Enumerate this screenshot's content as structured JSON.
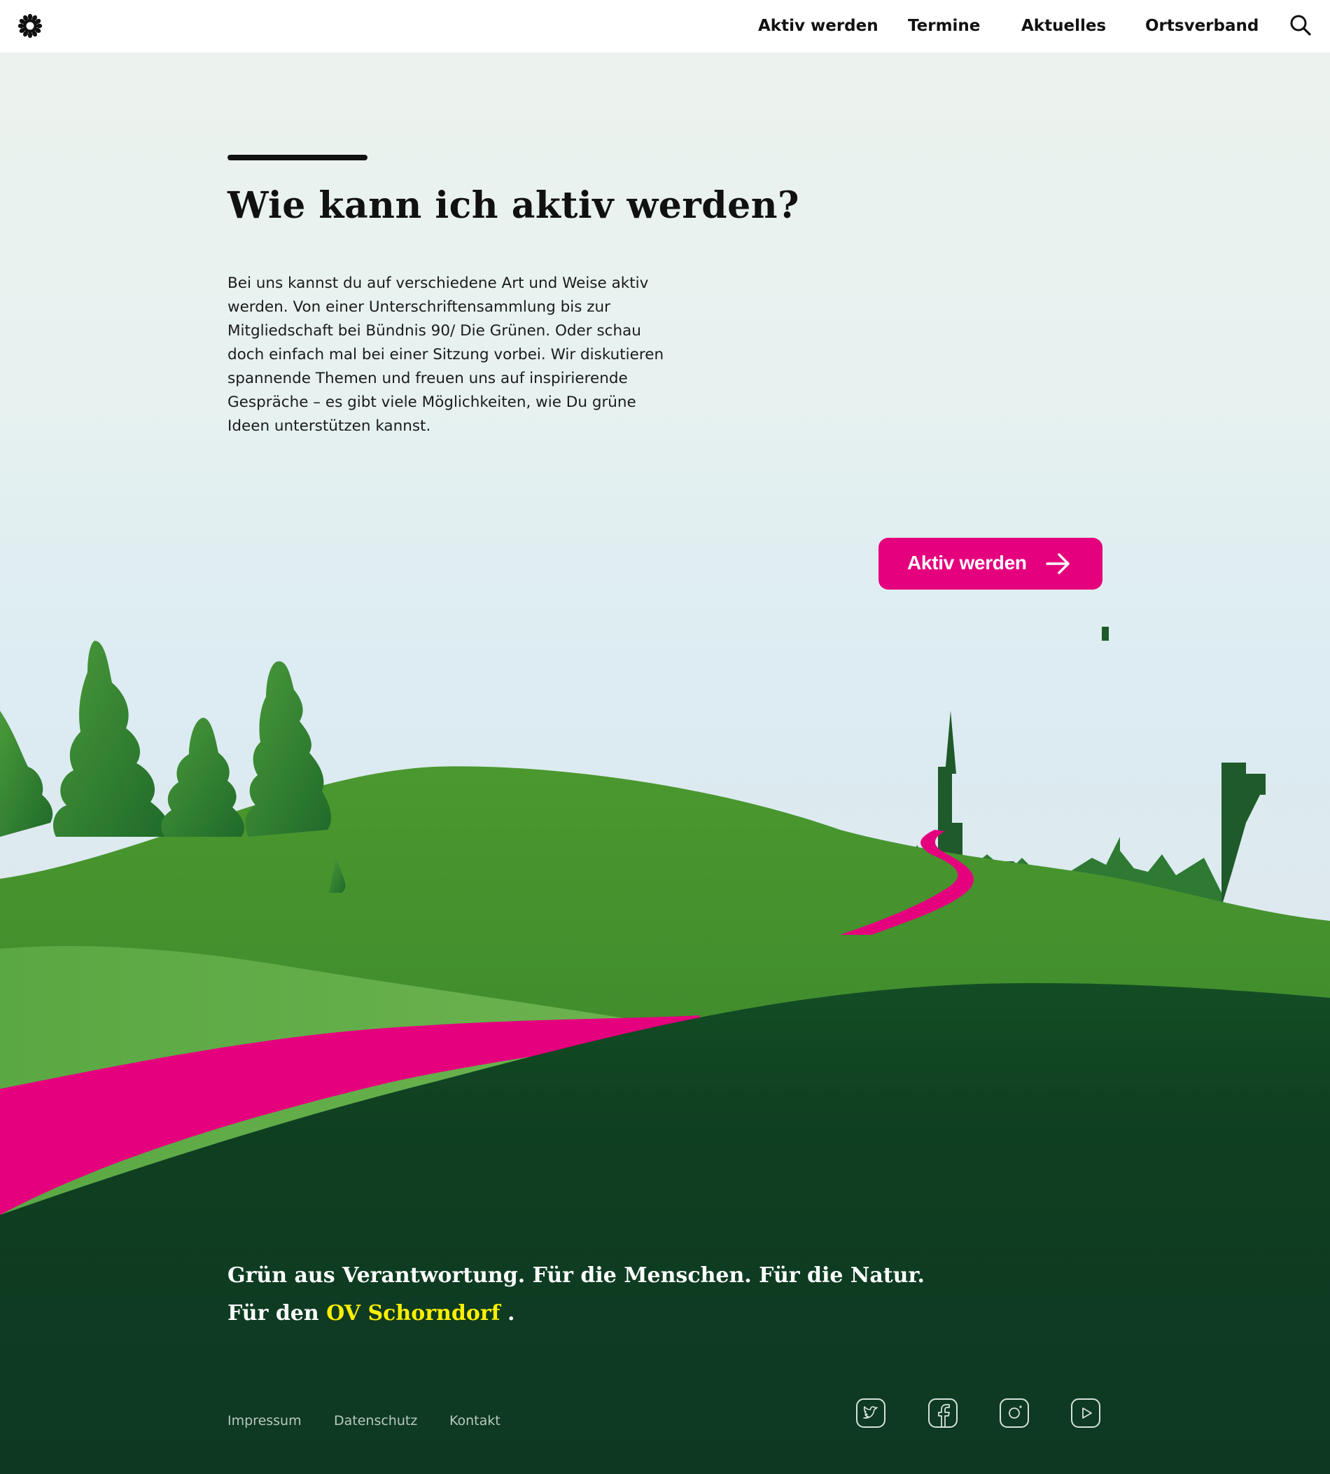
{
  "header": {
    "nav": [
      {
        "label": "Aktiv werden"
      },
      {
        "label": "Termine"
      },
      {
        "label": "Aktuelles"
      },
      {
        "label": "Ortsverband"
      }
    ],
    "logo_icon": "sunflower-logo-icon",
    "search_icon": "search-icon"
  },
  "hero": {
    "title": "Wie kann ich aktiv werden?",
    "intro": "Bei uns kannst du auf verschiedene Art und Weise aktiv werden. Von einer Unterschriftensammlung bis zur Mitgliedschaft bei Bündnis 90/ Die Grünen. Oder schau doch einfach mal bei einer Sitzung vorbei. Wir diskutieren spannende Themen und freuen uns auf inspirierende Gespräche – es gibt viele Möglichkeiten, wie Du grüne Ideen unterstützen kannst.",
    "cta_label": "Aktiv werden",
    "cta_icon": "arrow-right-icon"
  },
  "footer": {
    "slogan_line1": "Grün aus Verantwortung. Für die Menschen. Für die Natur.",
    "slogan_line2_prefix": "Für den ",
    "slogan_line2_highlight": "OV Schorndorf",
    "slogan_line2_suffix": " .",
    "links": [
      {
        "label": "Impressum"
      },
      {
        "label": "Datenschutz"
      },
      {
        "label": "Kontakt"
      }
    ],
    "social_icons": [
      "twitter-icon",
      "facebook-icon",
      "instagram-icon",
      "youtube-icon"
    ]
  },
  "colors": {
    "accent_magenta": "#e5007d",
    "footer_dark_green": "#0f3a22",
    "highlight_yellow": "#fff000"
  }
}
